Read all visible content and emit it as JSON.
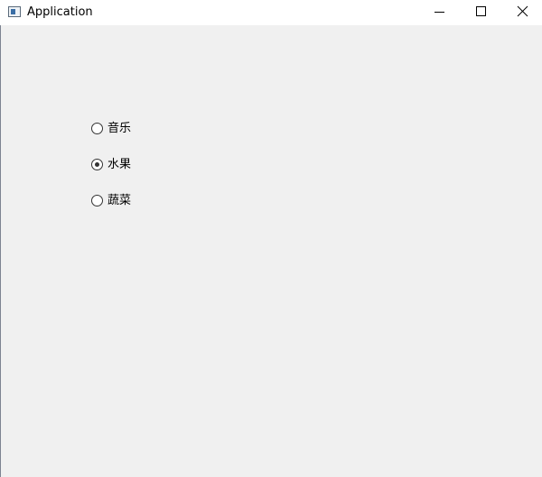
{
  "window": {
    "title": "Application",
    "icon": "app-window-icon",
    "controls": {
      "minimize_icon": "minimize-icon",
      "maximize_icon": "maximize-icon",
      "close_icon": "close-icon"
    }
  },
  "radio_group": {
    "options": [
      {
        "label": "音乐",
        "checked": false
      },
      {
        "label": "水果",
        "checked": true
      },
      {
        "label": "蔬菜",
        "checked": false
      }
    ]
  }
}
